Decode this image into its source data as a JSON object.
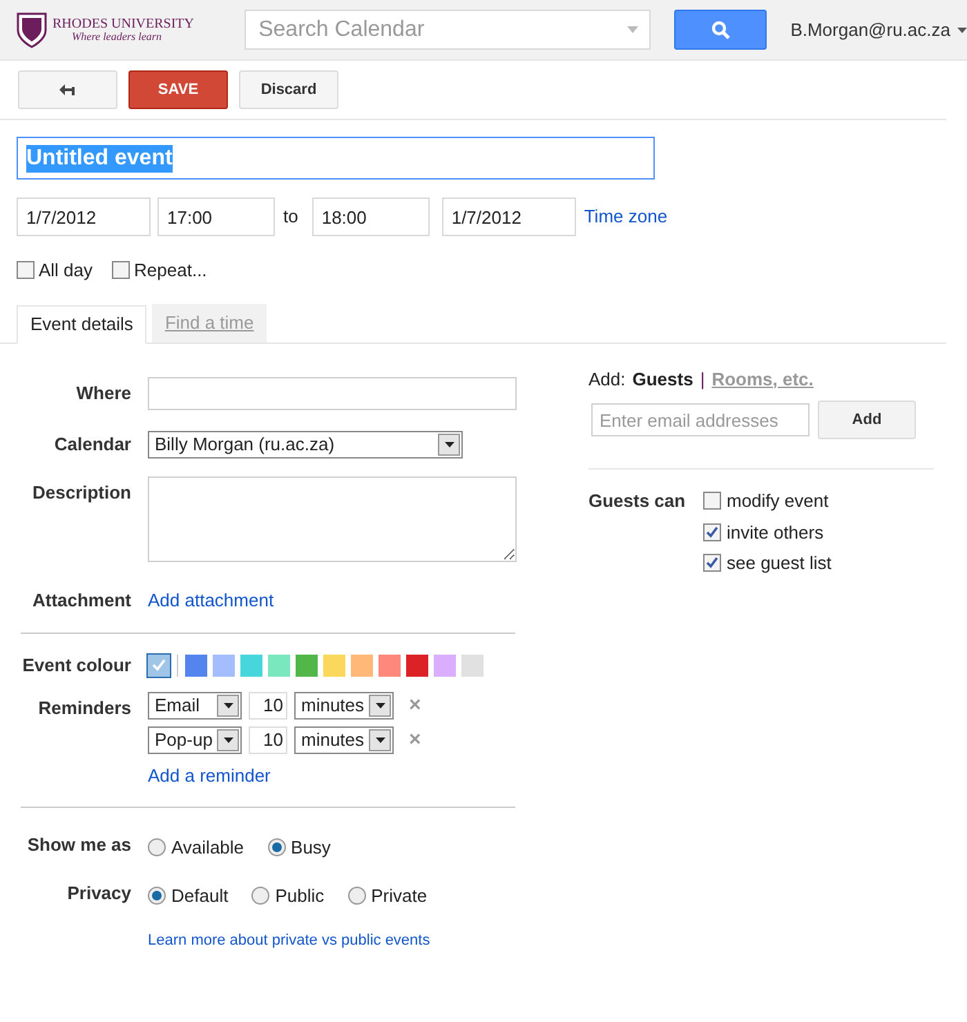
{
  "header": {
    "logo_title": "RHODES UNIVERSITY",
    "logo_tagline": "Where leaders learn",
    "search_placeholder": "Search Calendar",
    "account": "B.Morgan@ru.ac.za"
  },
  "toolbar": {
    "save": "SAVE",
    "discard": "Discard"
  },
  "event": {
    "title": "Untitled event",
    "start_date": "1/7/2012",
    "start_time": "17:00",
    "to": "to",
    "end_time": "18:00",
    "end_date": "1/7/2012",
    "time_zone": "Time zone"
  },
  "options": [
    {
      "label": "All day",
      "checked": false
    },
    {
      "label": "Repeat...",
      "checked": false
    }
  ],
  "tabs": [
    {
      "label": "Event details",
      "selected": true
    },
    {
      "label": "Find a time",
      "selected": false
    }
  ],
  "details": {
    "where_label": "Where",
    "calendar_label": "Calendar",
    "calendar_value": "Billy Morgan (ru.ac.za)",
    "description_label": "Description",
    "attachment_label": "Attachment",
    "attachment_link": "Add attachment",
    "colour_label": "Event colour",
    "reminders_label": "Reminders",
    "add_reminder": "Add a reminder",
    "show_label": "Show me as",
    "privacy_label": "Privacy",
    "learn_more": "Learn more about private vs public events"
  },
  "colours": [
    {
      "color": "#9fc6e7",
      "selected": true
    },
    {
      "color": "#5484ed",
      "selected": false
    },
    {
      "color": "#a4bdfc",
      "selected": false
    },
    {
      "color": "#46d6db",
      "selected": false
    },
    {
      "color": "#7ae7bf",
      "selected": false
    },
    {
      "color": "#51b749",
      "selected": false
    },
    {
      "color": "#fbd75b",
      "selected": false
    },
    {
      "color": "#ffb878",
      "selected": false
    },
    {
      "color": "#ff887c",
      "selected": false
    },
    {
      "color": "#dc2127",
      "selected": false
    },
    {
      "color": "#dbadff",
      "selected": false
    },
    {
      "color": "#e1e1e1",
      "selected": false
    }
  ],
  "reminders": [
    {
      "method": "Email",
      "amount": "10",
      "unit": "minutes",
      "remove": "×"
    },
    {
      "method": "Pop-up",
      "amount": "10",
      "unit": "minutes",
      "remove": "×"
    }
  ],
  "show_me_as": [
    {
      "label": "Available",
      "selected": false
    },
    {
      "label": "Busy",
      "selected": true
    }
  ],
  "privacy": [
    {
      "label": "Default",
      "selected": true
    },
    {
      "label": "Public",
      "selected": false
    },
    {
      "label": "Private",
      "selected": false
    }
  ],
  "guests": {
    "add_label": "Add:",
    "guests_tab": "Guests",
    "separator": "|",
    "rooms_tab": "Rooms, etc.",
    "email_placeholder": "Enter email addresses",
    "add_button": "Add",
    "can_label": "Guests can"
  },
  "permissions": [
    {
      "label": "modify event",
      "checked": false
    },
    {
      "label": "invite others",
      "checked": true
    },
    {
      "label": "see guest list",
      "checked": true
    }
  ]
}
